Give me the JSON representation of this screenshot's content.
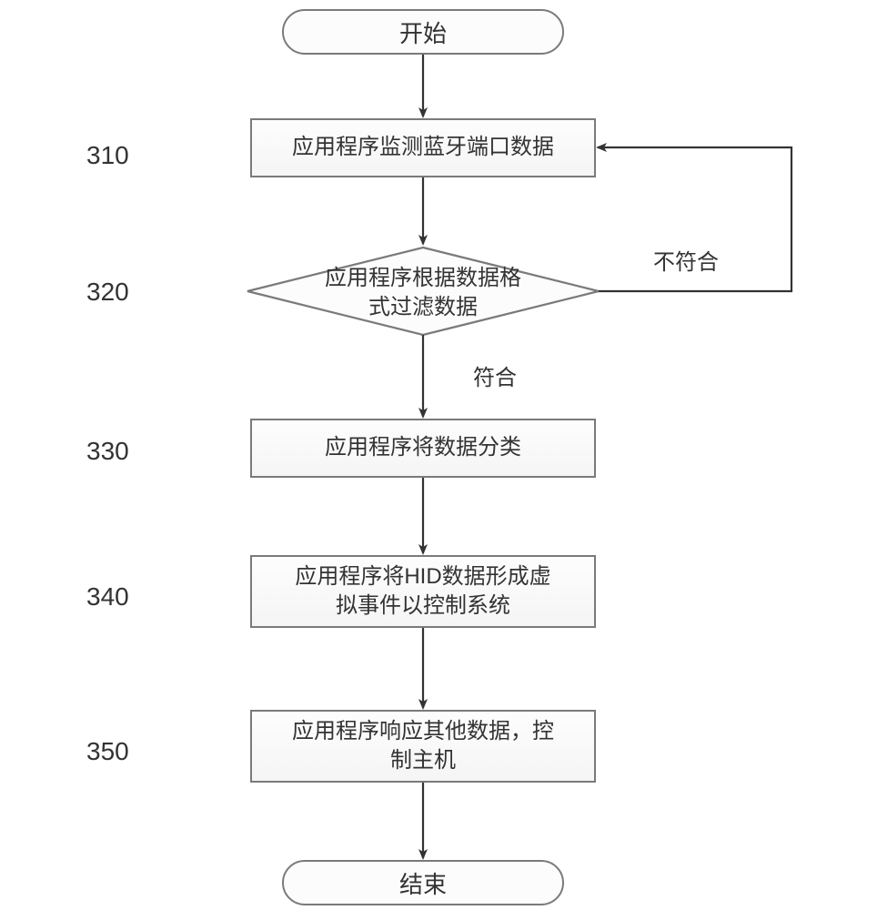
{
  "labels": {
    "s310": "310",
    "s320": "320",
    "s330": "330",
    "s340": "340",
    "s350": "350"
  },
  "nodes": {
    "start": "开始",
    "n310": "应用程序监测蓝牙端口数据",
    "n320_line1": "应用程序根据数据格",
    "n320_line2": "式过滤数据",
    "n330": "应用程序将数据分类",
    "n340_line1": "应用程序将HID数据形成虚",
    "n340_line2": "拟事件以控制系统",
    "n350_line1": "应用程序响应其他数据，控",
    "n350_line2": "制主机",
    "end": "结束"
  },
  "edges": {
    "pass": "符合",
    "fail": "不符合"
  },
  "chart_data": {
    "type": "flowchart",
    "title": "",
    "nodes": [
      {
        "id": "start",
        "type": "terminator",
        "label": "开始"
      },
      {
        "id": "310",
        "type": "process",
        "label": "应用程序监测蓝牙端口数据"
      },
      {
        "id": "320",
        "type": "decision",
        "label": "应用程序根据数据格式过滤数据"
      },
      {
        "id": "330",
        "type": "process",
        "label": "应用程序将数据分类"
      },
      {
        "id": "340",
        "type": "process",
        "label": "应用程序将HID数据形成虚拟事件以控制系统"
      },
      {
        "id": "350",
        "type": "process",
        "label": "应用程序响应其他数据，控制主机"
      },
      {
        "id": "end",
        "type": "terminator",
        "label": "结束"
      }
    ],
    "edges": [
      {
        "from": "start",
        "to": "310"
      },
      {
        "from": "310",
        "to": "320"
      },
      {
        "from": "320",
        "to": "330",
        "label": "符合"
      },
      {
        "from": "320",
        "to": "310",
        "label": "不符合"
      },
      {
        "from": "330",
        "to": "340"
      },
      {
        "from": "340",
        "to": "350"
      },
      {
        "from": "350",
        "to": "end"
      }
    ]
  }
}
